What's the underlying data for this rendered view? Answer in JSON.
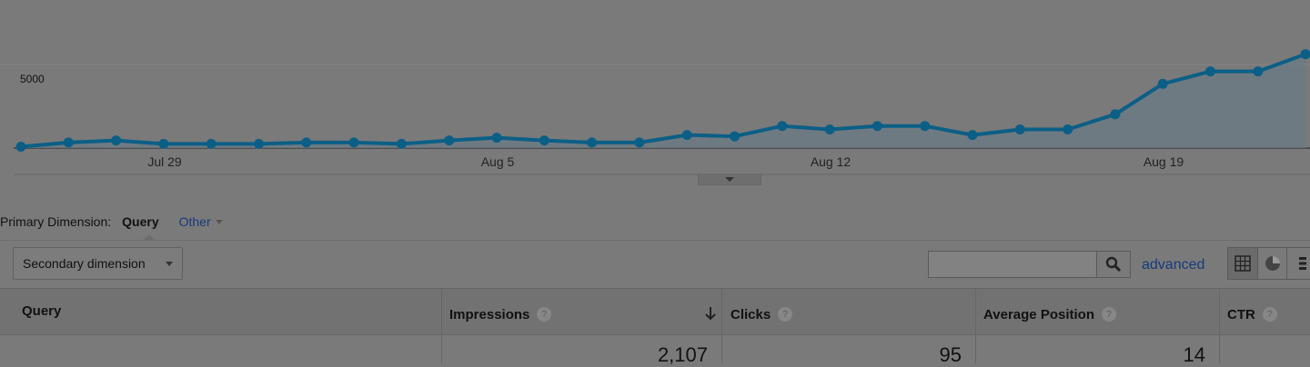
{
  "chart": {
    "y_tick_label": "5000",
    "x_tick_labels": [
      "Jul 29",
      "Aug 5",
      "Aug 12",
      "Aug 19"
    ],
    "line_color": "#0b5f86",
    "fill_color": "#6c7a84",
    "chart_data": {
      "type": "area",
      "y_ticks": [
        5000
      ],
      "values": [
        100,
        400,
        550,
        300,
        300,
        300,
        400,
        400,
        300,
        550,
        750,
        550,
        400,
        400,
        950,
        850,
        1600,
        1350,
        1600,
        1600,
        950,
        1350,
        1350,
        2450,
        4650,
        5550,
        5550,
        6800
      ]
    }
  },
  "dimension_bar": {
    "label": "Primary Dimension:",
    "active": "Query",
    "other": "Other"
  },
  "secondary_dimension": {
    "label": "Secondary dimension"
  },
  "search": {
    "value": "",
    "button_icon": "search-icon"
  },
  "advanced_link": "advanced",
  "view_toggles": [
    "grid-icon",
    "pie-icon",
    "more-icon"
  ],
  "table": {
    "headers": [
      {
        "label": "Query",
        "help": false
      },
      {
        "label": "Impressions",
        "help": true,
        "sorted": "desc"
      },
      {
        "label": "Clicks",
        "help": true
      },
      {
        "label": "Average Position",
        "help": true
      },
      {
        "label": "CTR",
        "help": true
      }
    ],
    "help_glyph": "?",
    "first_row": {
      "impressions": "2,107",
      "clicks": "95",
      "position": "14"
    }
  }
}
